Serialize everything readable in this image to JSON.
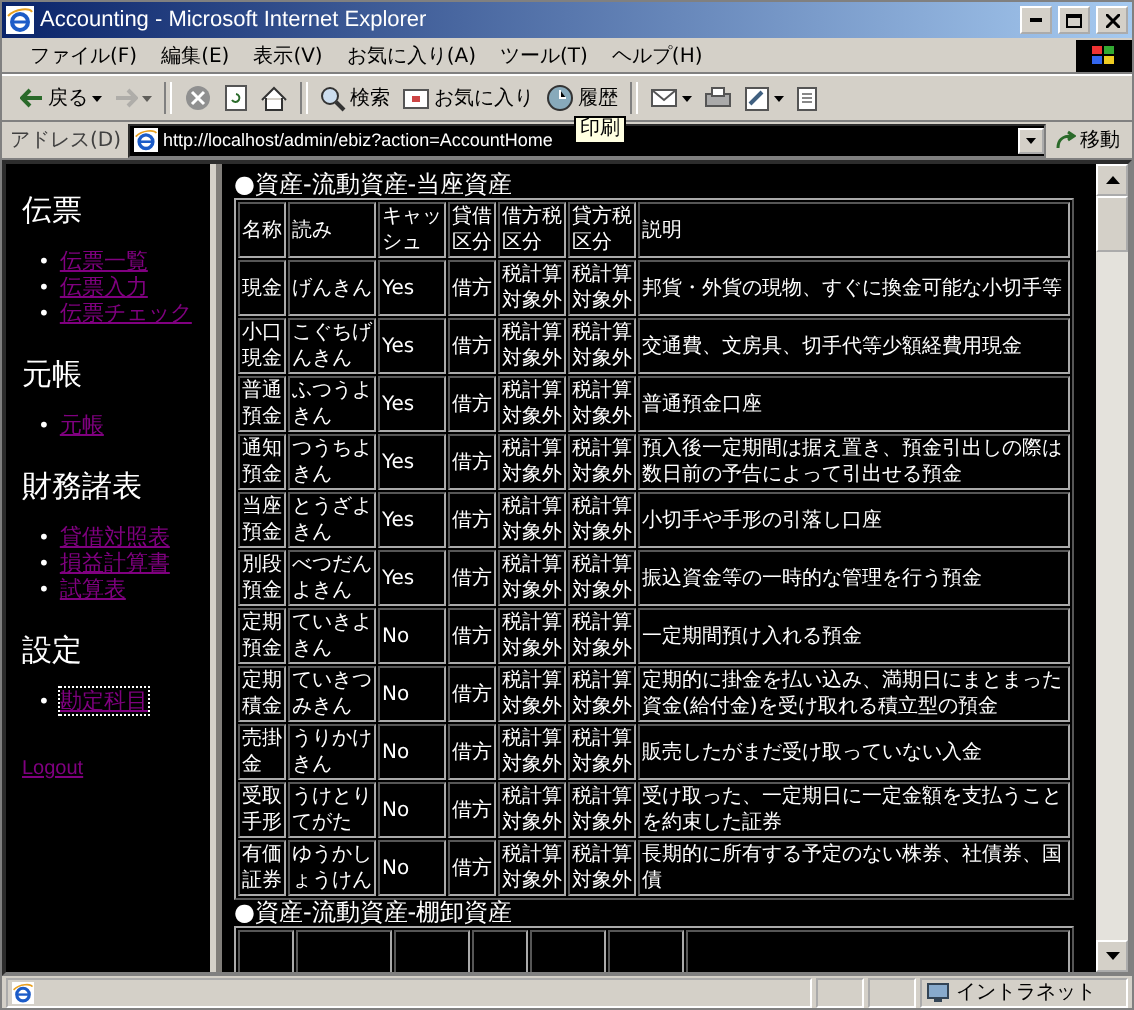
{
  "window": {
    "title": "Accounting - Microsoft Internet Explorer"
  },
  "menu": [
    "ファイル(F)",
    "編集(E)",
    "表示(V)",
    "お気に入り(A)",
    "ツール(T)",
    "ヘルプ(H)"
  ],
  "toolbar": {
    "groups": [
      [
        {
          "kind": "back",
          "label": "戻る",
          "dropdown": true,
          "disabled": false
        },
        {
          "kind": "forward",
          "dropdown": true,
          "disabled": true
        }
      ],
      [
        {
          "kind": "stop",
          "disabled": false
        },
        {
          "kind": "refresh",
          "disabled": false
        },
        {
          "kind": "home",
          "disabled": false
        }
      ],
      [
        {
          "kind": "search",
          "label": "検索",
          "disabled": false
        },
        {
          "kind": "favorites",
          "label": "お気に入り",
          "disabled": false
        },
        {
          "kind": "history",
          "label": "履歴",
          "disabled": false
        }
      ],
      [
        {
          "kind": "mail",
          "dropdown": true,
          "disabled": false
        },
        {
          "kind": "print",
          "disabled": false
        },
        {
          "kind": "edit",
          "dropdown": true,
          "disabled": false
        },
        {
          "kind": "discuss",
          "disabled": false
        }
      ]
    ],
    "tooltip": "印刷"
  },
  "address": {
    "label": "アドレス(D)",
    "url": "http://localhost/admin/ebiz?action=AccountHome",
    "go": "移動"
  },
  "sidebar": {
    "sections": [
      {
        "heading": "伝票",
        "links": [
          {
            "label": "伝票一覧",
            "focused": false
          },
          {
            "label": "伝票入力",
            "focused": false
          },
          {
            "label": "伝票チェック",
            "focused": false
          }
        ]
      },
      {
        "heading": "元帳",
        "links": [
          {
            "label": "元帳",
            "focused": false
          }
        ]
      },
      {
        "heading": "財務諸表",
        "links": [
          {
            "label": "貸借対照表",
            "focused": false
          },
          {
            "label": "損益計算書",
            "focused": false
          },
          {
            "label": "試算表",
            "focused": false
          }
        ]
      },
      {
        "heading": "設定",
        "links": [
          {
            "label": "勘定科目",
            "focused": true
          }
        ]
      }
    ],
    "bullet": "•",
    "logout": "Logout"
  },
  "sections": [
    {
      "heading": "●資産-流動資産-当座資産",
      "columns": [
        "名称",
        "読み",
        "キャッシュ",
        "貸借区分",
        "借方税区分",
        "貸方税区分",
        "説明"
      ],
      "rows": [
        [
          "現金",
          "げんきん",
          "Yes",
          "借方",
          "税計算対象外",
          "税計算対象外",
          "邦貨・外貨の現物、すぐに換金可能な小切手等"
        ],
        [
          "小口現金",
          "こぐちげんきん",
          "Yes",
          "借方",
          "税計算対象外",
          "税計算対象外",
          "交通費、文房具、切手代等少額経費用現金"
        ],
        [
          "普通預金",
          "ふつうよきん",
          "Yes",
          "借方",
          "税計算対象外",
          "税計算対象外",
          "普通預金口座"
        ],
        [
          "通知預金",
          "つうちよきん",
          "Yes",
          "借方",
          "税計算対象外",
          "税計算対象外",
          "預入後一定期間は据え置き、預金引出しの際は数日前の予告によって引出せる預金"
        ],
        [
          "当座預金",
          "とうざよきん",
          "Yes",
          "借方",
          "税計算対象外",
          "税計算対象外",
          "小切手や手形の引落し口座"
        ],
        [
          "別段預金",
          "べつだんよきん",
          "Yes",
          "借方",
          "税計算対象外",
          "税計算対象外",
          "振込資金等の一時的な管理を行う預金"
        ],
        [
          "定期預金",
          "ていきよきん",
          "No",
          "借方",
          "税計算対象外",
          "税計算対象外",
          "一定期間預け入れる預金"
        ],
        [
          "定期積金",
          "ていきつみきん",
          "No",
          "借方",
          "税計算対象外",
          "税計算対象外",
          "定期的に掛金を払い込み、満期日にまとまった資金(給付金)を受け取れる積立型の預金"
        ],
        [
          "売掛金",
          "うりかけきん",
          "No",
          "借方",
          "税計算対象外",
          "税計算対象外",
          "販売したがまだ受け取っていない入金"
        ],
        [
          "受取手形",
          "うけとりてがた",
          "No",
          "借方",
          "税計算対象外",
          "税計算対象外",
          "受け取った、一定期日に一定金額を支払うことを約束した証券"
        ],
        [
          "有価証券",
          "ゆうかしょうけん",
          "No",
          "借方",
          "税計算対象外",
          "税計算対象外",
          "長期的に所有する予定のない株券、社債券、国債"
        ]
      ]
    },
    {
      "heading": "●資産-流動資産-棚卸資産"
    }
  ],
  "status_bar": {
    "zone": "イントラネット"
  }
}
